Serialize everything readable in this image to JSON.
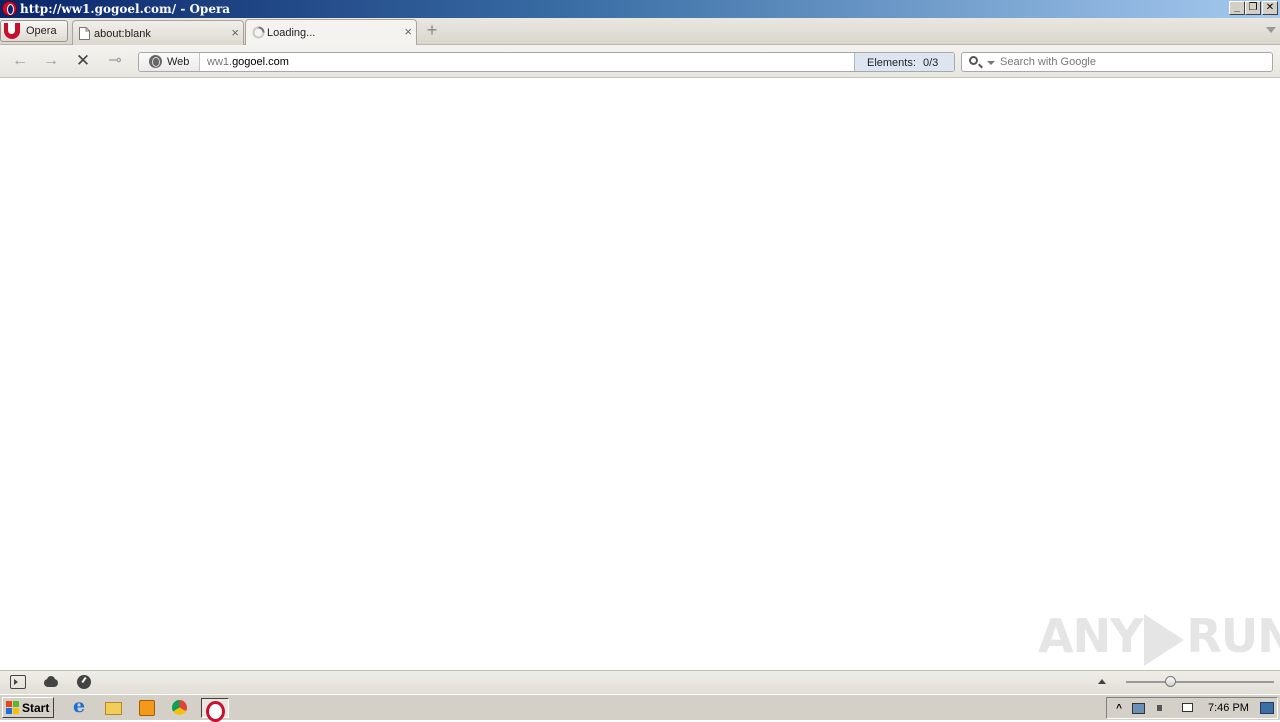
{
  "window": {
    "title": "http://ww1.gogoel.com/ - Opera",
    "controls": {
      "minimize": "_",
      "restore": "❐",
      "close": "✕"
    }
  },
  "menu_button": {
    "label": "Opera"
  },
  "tabs": [
    {
      "label": "about:blank",
      "icon": "page-icon",
      "active": false
    },
    {
      "label": "Loading...",
      "icon": "loading-spinner-icon",
      "active": true
    }
  ],
  "navigation": {
    "back_glyph": "←",
    "forward_glyph": "→",
    "stop_glyph": "✕",
    "key_glyph": "⊸"
  },
  "address_bar": {
    "mode_label": "Web",
    "url_prefix": "ww1.",
    "url_domain": "gogoel.com",
    "elements_label": "Elements:",
    "elements_count": "0/3"
  },
  "search": {
    "placeholder": "Search with Google",
    "value": ""
  },
  "watermark": {
    "left": "ANY",
    "right": "RUN"
  },
  "statusbar": {
    "zoom_level_percent": 30
  },
  "taskbar": {
    "start_label": "Start",
    "apps": [
      "ie-icon",
      "explorer-icon",
      "media-player-icon",
      "chrome-icon",
      "opera-icon"
    ],
    "clock": "7:46 PM"
  },
  "colors": {
    "title_gradient_start": "#0a246a",
    "title_gradient_end": "#a6caf0",
    "opera_red": "#c8102e",
    "taskbar": "#d4d0c8"
  }
}
